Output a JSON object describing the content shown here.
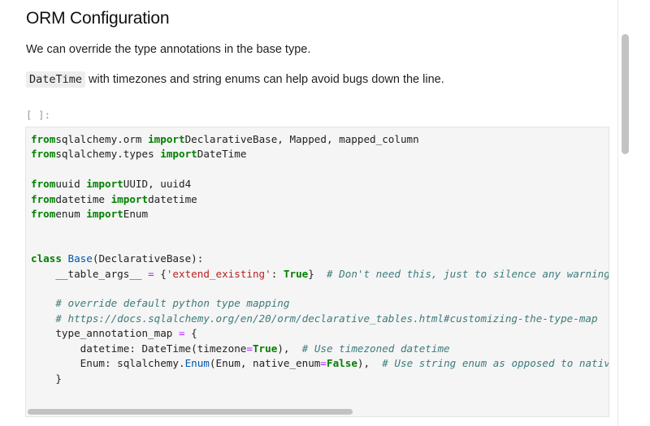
{
  "notebook": {
    "title": "ORM Configuration",
    "paragraph_1": "We can override the type annotations in the base type.",
    "paragraph_2_code": "DateTime",
    "paragraph_2_text": " with timezones and string enums can help avoid bugs down the line.",
    "cell_prompt": "[ ]:",
    "code_lines": [
      [
        [
          "kw",
          "from"
        ],
        [
          "",
          "sqlalchemy.orm "
        ],
        [
          "kw",
          "import"
        ],
        [
          "",
          "DeclarativeBase, Mapped, mapped_column"
        ]
      ],
      [
        [
          "kw",
          "from"
        ],
        [
          "",
          "sqlalchemy.types "
        ],
        [
          "kw",
          "import"
        ],
        [
          "",
          "DateTime"
        ]
      ],
      [],
      [
        [
          "kw",
          "from"
        ],
        [
          "",
          "uuid "
        ],
        [
          "kw",
          "import"
        ],
        [
          "",
          "UUID, uuid4"
        ]
      ],
      [
        [
          "kw",
          "from"
        ],
        [
          "",
          "datetime "
        ],
        [
          "kw",
          "import"
        ],
        [
          "",
          "datetime"
        ]
      ],
      [
        [
          "kw",
          "from"
        ],
        [
          "",
          "enum "
        ],
        [
          "kw",
          "import"
        ],
        [
          "",
          "Enum"
        ]
      ],
      [],
      [],
      [
        [
          "kw",
          "class"
        ],
        [
          "",
          " "
        ],
        [
          "cls",
          "Base"
        ],
        [
          "",
          "(DeclarativeBase):"
        ]
      ],
      [
        [
          "",
          "    __table_args__ "
        ],
        [
          "op",
          "="
        ],
        [
          "",
          " {"
        ],
        [
          "str",
          "'extend_existing'"
        ],
        [
          "",
          ": "
        ],
        [
          "kw",
          "True"
        ],
        [
          "",
          "}  "
        ],
        [
          "cm",
          "# Don't need this, just to silence any warnings"
        ]
      ],
      [],
      [
        [
          "",
          "    "
        ],
        [
          "cm",
          "# override default python type mapping"
        ]
      ],
      [
        [
          "",
          "    "
        ],
        [
          "cm",
          "# https://docs.sqlalchemy.org/en/20/orm/declarative_tables.html#customizing-the-type-map"
        ]
      ],
      [
        [
          "",
          "    type_annotation_map "
        ],
        [
          "op",
          "="
        ],
        [
          "",
          " {"
        ]
      ],
      [
        [
          "",
          "        datetime: DateTime(timezone"
        ],
        [
          "op",
          "="
        ],
        [
          "kw",
          "True"
        ],
        [
          "",
          "),  "
        ],
        [
          "cm",
          "# Use timezoned datetime"
        ]
      ],
      [
        [
          "",
          "        Enum: sqlalchemy."
        ],
        [
          "fn",
          "Enum"
        ],
        [
          "",
          "(Enum, native_enum"
        ],
        [
          "op",
          "="
        ],
        [
          "kw",
          "False"
        ],
        [
          "",
          "),  "
        ],
        [
          "cm",
          "# Use string enum as opposed to native enum"
        ]
      ],
      [
        [
          "",
          "    }"
        ]
      ]
    ]
  }
}
